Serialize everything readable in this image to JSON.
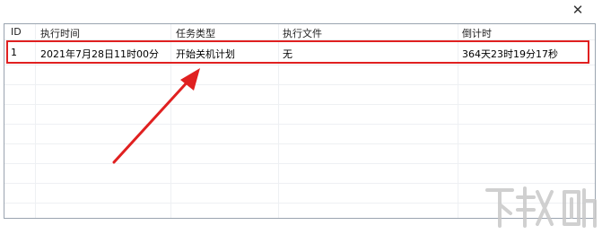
{
  "window": {
    "close_icon": "close-icon"
  },
  "table": {
    "columns": [
      "ID",
      "执行时间",
      "任务类型",
      "执行文件",
      "倒计时"
    ],
    "rows": [
      {
        "id": "1",
        "time": "2021年7月28日11时00分",
        "type": "开始关机计划",
        "file": "无",
        "countdown": "364天23时19分17秒"
      }
    ]
  },
  "annotation": {
    "color": "#e02020"
  },
  "watermark": {
    "text": "下载吧"
  }
}
